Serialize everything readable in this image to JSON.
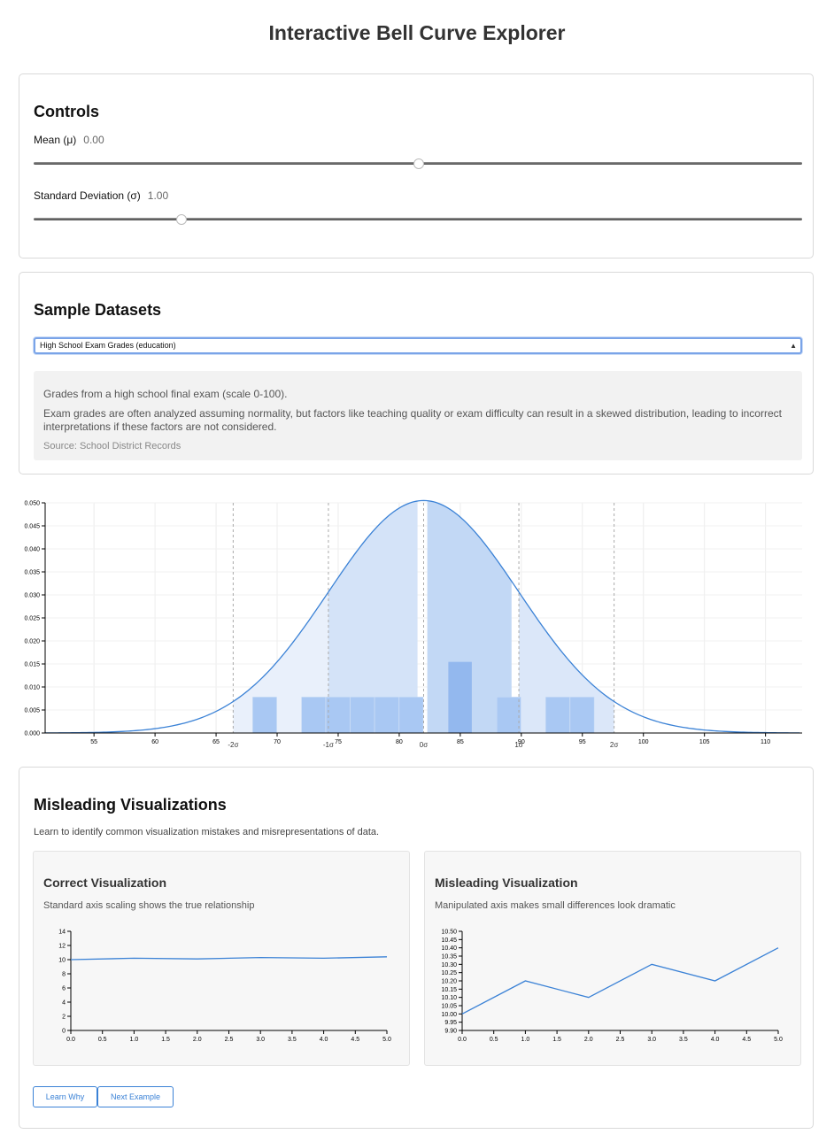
{
  "page": {
    "title": "Interactive Bell Curve Explorer"
  },
  "controls": {
    "heading": "Controls",
    "mean": {
      "label": "Mean (μ)",
      "value": "0.00",
      "fraction": 0.5
    },
    "std": {
      "label": "Standard Deviation (σ)",
      "value": "1.00",
      "fraction": 0.188
    }
  },
  "datasets": {
    "heading": "Sample Datasets",
    "selected": "High School Exam Grades (education)",
    "description": "Grades from a high school final exam (scale 0-100).",
    "note": "Exam grades are often analyzed assuming normality, but factors like teaching quality or exam difficulty can result in a skewed distribution, leading to incorrect interpretations if these factors are not considered.",
    "source": "Source: School District Records"
  },
  "chart_data": [
    {
      "type": "area",
      "xlim": [
        51,
        113
      ],
      "ylim": [
        0,
        0.05
      ],
      "x_ticks": [
        55,
        60,
        65,
        70,
        75,
        80,
        85,
        90,
        95,
        100,
        105,
        110
      ],
      "y_ticks": [
        "0.000",
        "0.005",
        "0.010",
        "0.015",
        "0.020",
        "0.025",
        "0.030",
        "0.035",
        "0.040",
        "0.045",
        "0.050"
      ],
      "curve": {
        "mean": 82,
        "sd": 7.8
      },
      "sigma_labels": [
        "-2σ",
        "-1σ",
        "0σ",
        "1σ",
        "2σ"
      ],
      "sigma_offsets": [
        -2,
        -1,
        0,
        1,
        2
      ],
      "sigma_bands": [
        {
          "from": 66.4,
          "to": 74.2,
          "shade": "#e9f0fb"
        },
        {
          "from": 74.2,
          "to": 81.5,
          "shade": "#d4e3f8"
        },
        {
          "from": 82.3,
          "to": 89.2,
          "shade": "#c2d8f5"
        },
        {
          "from": 89.8,
          "to": 97.6,
          "shade": "#dbe7f9"
        }
      ],
      "histogram": [
        {
          "x0": 68,
          "x1": 70,
          "y": 0.0078
        },
        {
          "x0": 72,
          "x1": 74,
          "y": 0.0078
        },
        {
          "x0": 74,
          "x1": 76,
          "y": 0.0078
        },
        {
          "x0": 76,
          "x1": 78,
          "y": 0.0078
        },
        {
          "x0": 78,
          "x1": 80,
          "y": 0.0078
        },
        {
          "x0": 80,
          "x1": 82,
          "y": 0.0078
        },
        {
          "x0": 84,
          "x1": 86,
          "y": 0.0155
        },
        {
          "x0": 88,
          "x1": 90,
          "y": 0.0078
        },
        {
          "x0": 92,
          "x1": 94,
          "y": 0.0078
        },
        {
          "x0": 94,
          "x1": 96,
          "y": 0.0078
        }
      ],
      "grid": true,
      "colors": {
        "curve": "#3b82d6",
        "bar": "#a9c8f3",
        "bar_dark": "#93b8ee"
      }
    },
    {
      "type": "line",
      "x": [
        0,
        1,
        2,
        3,
        4,
        5
      ],
      "values": [
        10.0,
        10.2,
        10.1,
        10.3,
        10.2,
        10.4
      ],
      "xlim": [
        0,
        5
      ],
      "ylim": [
        0,
        14
      ],
      "x_ticks": [
        "0.0",
        "0.5",
        "1.0",
        "1.5",
        "2.0",
        "2.5",
        "3.0",
        "3.5",
        "4.0",
        "4.5",
        "5.0"
      ],
      "y_ticks": [
        "0",
        "2",
        "4",
        "6",
        "8",
        "10",
        "12",
        "14"
      ]
    },
    {
      "type": "line",
      "x": [
        0,
        1,
        2,
        3,
        4,
        5
      ],
      "values": [
        10.0,
        10.2,
        10.1,
        10.3,
        10.2,
        10.4
      ],
      "xlim": [
        0,
        5
      ],
      "ylim": [
        9.9,
        10.5
      ],
      "x_ticks": [
        "0.0",
        "0.5",
        "1.0",
        "1.5",
        "2.0",
        "2.5",
        "3.0",
        "3.5",
        "4.0",
        "4.5",
        "5.0"
      ],
      "y_ticks": [
        "9.90",
        "9.95",
        "10.00",
        "10.05",
        "10.10",
        "10.15",
        "10.20",
        "10.25",
        "10.30",
        "10.35",
        "10.40",
        "10.45",
        "10.50"
      ]
    }
  ],
  "misleading": {
    "heading": "Misleading Visualizations",
    "intro": "Learn to identify common visualization mistakes and misrepresentations of data.",
    "correct": {
      "title": "Correct Visualization",
      "desc": "Standard axis scaling shows the true relationship"
    },
    "wrong": {
      "title": "Misleading Visualization",
      "desc": "Manipulated axis makes small differences look dramatic"
    },
    "learn_button": "Learn Why",
    "next_button": "Next Example"
  }
}
